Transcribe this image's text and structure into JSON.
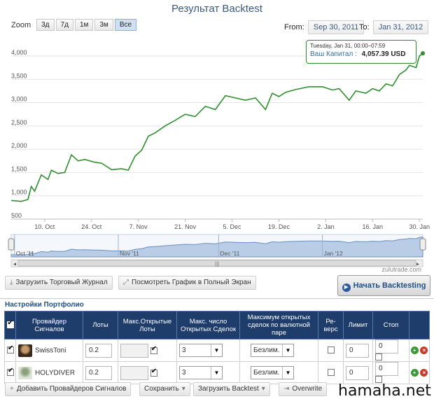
{
  "title": "Результат Backtest",
  "zoom": {
    "label": "Zoom",
    "buttons": [
      "3д",
      "7д",
      "1м",
      "3м",
      "Все"
    ],
    "active": "Все"
  },
  "range": {
    "from_label": "From:",
    "from_value": "Sep 30, 2011",
    "to_label": "To:",
    "to_value": "Jan 31, 2012"
  },
  "tooltip": {
    "date": "Tuesday, Jan 31, 00:00–07:59",
    "label": "Ваш Капитал :",
    "value": "4,057.39 USD"
  },
  "credit": "zulutrade.com",
  "colors": {
    "line": "#2f8f2f",
    "header": "#1e3d6b",
    "accent": "#1e4f8a"
  },
  "chart_data": {
    "type": "line",
    "title": "Результат Backtest",
    "ylim": [
      500,
      4300
    ],
    "yticks": [
      "500",
      "1,000",
      "1,500",
      "2,000",
      "2,500",
      "3,000",
      "3,500",
      "4,000"
    ],
    "xticks": [
      "10. Oct",
      "24. Oct",
      "7. Nov",
      "21. Nov",
      "5. Dec",
      "19. Dec",
      "2. Jan",
      "16. Jan",
      "30. Jan"
    ],
    "navigator_labels": [
      "Oct '11",
      "Nov '11",
      "Dec '11",
      "Jan '12"
    ],
    "series": [
      {
        "x": [
          "2011-09-30",
          "2011-10-03",
          "2011-10-05",
          "2011-10-06",
          "2011-10-07",
          "2011-10-09",
          "2011-10-11",
          "2011-10-12",
          "2011-10-14",
          "2011-10-16",
          "2011-10-18",
          "2011-10-20",
          "2011-10-22",
          "2011-10-25",
          "2011-10-27",
          "2011-10-30",
          "2011-11-02",
          "2011-11-04",
          "2011-11-06",
          "2011-11-08",
          "2011-11-10",
          "2011-11-12",
          "2011-11-15",
          "2011-11-18",
          "2011-11-21",
          "2011-11-24",
          "2011-11-27",
          "2011-11-30",
          "2011-12-03",
          "2011-12-06",
          "2011-12-09",
          "2011-12-12",
          "2011-12-15",
          "2011-12-17",
          "2011-12-19",
          "2011-12-21",
          "2011-12-24",
          "2011-12-28",
          "2012-01-01",
          "2012-01-04",
          "2012-01-06",
          "2012-01-09",
          "2012-01-11",
          "2012-01-14",
          "2012-01-16",
          "2012-01-18",
          "2012-01-20",
          "2012-01-22",
          "2012-01-24",
          "2012-01-26",
          "2012-01-27",
          "2012-01-29",
          "2012-01-30",
          "2012-01-31"
        ],
        "values": [
          900,
          880,
          920,
          1200,
          1100,
          1450,
          1350,
          1550,
          1480,
          1500,
          1880,
          1750,
          1780,
          1720,
          1700,
          1560,
          1580,
          1550,
          1850,
          1980,
          2280,
          2350,
          2500,
          2620,
          2750,
          2700,
          2920,
          2850,
          3150,
          3100,
          3050,
          3100,
          2850,
          3200,
          3130,
          3220,
          3280,
          3340,
          3340,
          3270,
          3300,
          3050,
          3250,
          3200,
          3300,
          3250,
          3400,
          3360,
          3600,
          3700,
          3800,
          3750,
          4000,
          4057
        ]
      }
    ]
  },
  "actions": {
    "load_journal": "Загрузить Торговый Журнал",
    "fullscreen": "Посмотреть График в Полный Экран",
    "start": "Начать Backtesting"
  },
  "portfolio": {
    "title": "Настройки Портфолио",
    "headers": [
      "Провайдер Сигналов",
      "Лоты",
      "Макс.Открытые Лоты",
      "Макс. число Открытых Сделок",
      "Максимум открытых сделок по валютной паре",
      "Ре-верс",
      "Лимит",
      "Стоп"
    ],
    "rows": [
      {
        "name": "SwissToni",
        "lots": "0.2",
        "max_lots": "",
        "max_trades": "3",
        "max_pair": "Безлим.",
        "limit": "0",
        "stop": "0"
      },
      {
        "name": "HOLYDIVER",
        "lots": "0.2",
        "max_lots": "",
        "max_trades": "3",
        "max_pair": "Безлим.",
        "limit": "0",
        "stop": "0"
      }
    ]
  },
  "bottom": {
    "add_providers": "Добавить Провайдеров Сигналов",
    "save": "Сохранить",
    "load_backtest": "Загрузить Backtest",
    "overwrite": "Overwrite",
    "start": "Начать Backtesting"
  },
  "watermark": "hamaha.net"
}
